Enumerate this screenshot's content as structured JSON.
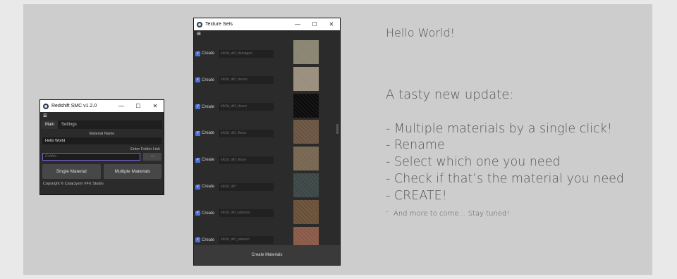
{
  "smc": {
    "title": "Redshift SMC v1.2.0",
    "min": "—",
    "max": "☐",
    "close": "✕",
    "menu": "≡",
    "tabs": [
      {
        "label": "Main"
      },
      {
        "label": "Settings"
      }
    ],
    "material_name_label": "Material Name",
    "material_name_value": "Hello World",
    "folder_label": "Enter Folder Link",
    "folder_placeholder": "Folder...",
    "browse_label": "...",
    "single_label": "Single Material",
    "multiple_label": "Multiple Materials",
    "copyright": "Copyright © Cataclysm VFX Studio"
  },
  "tex": {
    "title": "Texture Sets",
    "min": "—",
    "max": "☐",
    "close": "✕",
    "menu": "≡",
    "checkbox_glyph": "✓",
    "create_label": "Create",
    "rows": [
      {
        "name": "klk3d_dkf_damageo",
        "color": "#8a8472"
      },
      {
        "name": "klk3d_dkf_decoo",
        "color": "#9a8e7d"
      },
      {
        "name": "klk3d_dkf_doora",
        "color": "#0c0c0c"
      },
      {
        "name": "klk3d_dkf_floora",
        "color": "#6a5442"
      },
      {
        "name": "klk3d_dkf_floore",
        "color": "#776650"
      },
      {
        "name": "klk3d_dkf",
        "color": "#3c4746"
      },
      {
        "name": "klk3d_dkf_planksa",
        "color": "#6a5038"
      },
      {
        "name": "klk3d_dkf_planksc",
        "color": "#8a5a48"
      }
    ],
    "footer_label": "Create Materials"
  },
  "notes": {
    "hello": "Hello World!",
    "tasty": "A tasty new update:",
    "bullets": [
      "- Multiple materials by a single click!",
      "- Rename",
      "- Select which one you need",
      "- Check if that’s the material you need",
      "- CREATE!"
    ],
    "more_dash": "-",
    "more": "And more to come… Stay tuned!"
  }
}
